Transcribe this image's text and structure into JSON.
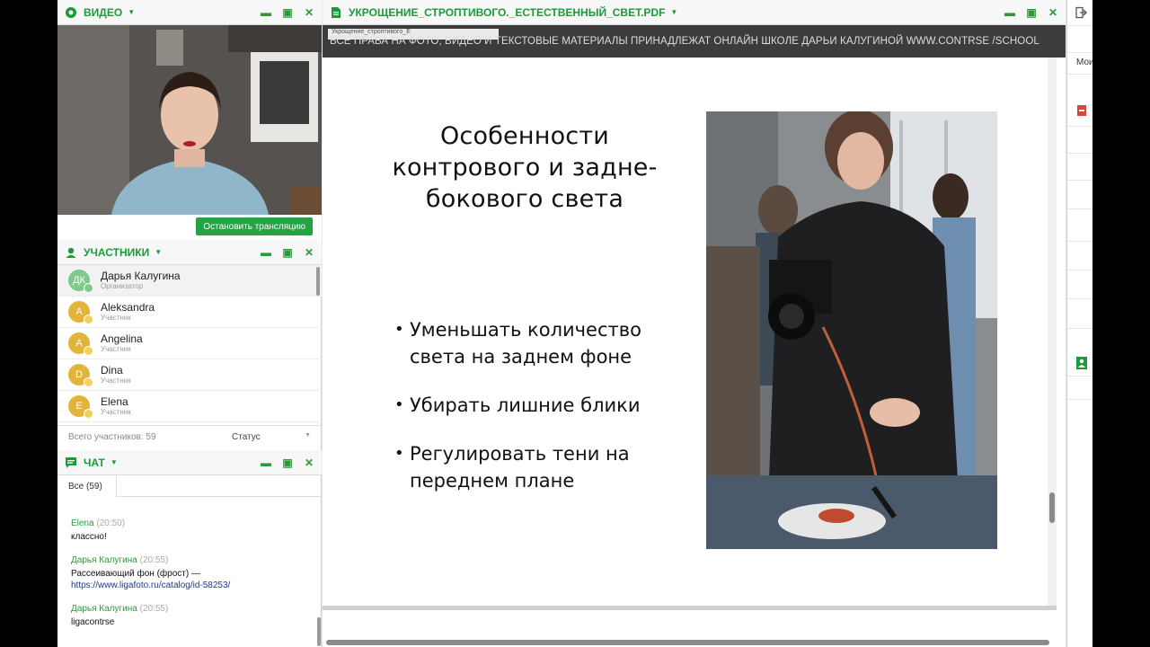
{
  "video": {
    "title": "ВИДЕО",
    "stop_button": "Остановить трансляцию"
  },
  "participants": {
    "title": "УЧАСТНИКИ",
    "list": [
      {
        "name": "Дарья Калугина",
        "role": "Организатор",
        "initials": "ДК",
        "color": "#7fc98a"
      },
      {
        "name": "Aleksandra",
        "role": "Участник",
        "initials": "A",
        "color": "#e2b43a"
      },
      {
        "name": "Angelina",
        "role": "Участник",
        "initials": "A",
        "color": "#e2b43a"
      },
      {
        "name": "Dina",
        "role": "Участник",
        "initials": "D",
        "color": "#e2b43a"
      },
      {
        "name": "Elena",
        "role": "Участник",
        "initials": "E",
        "color": "#e2b43a"
      }
    ],
    "total": "Всего участников: 59",
    "status_label": "Статус"
  },
  "chat": {
    "title": "ЧАТ",
    "tab_all": "Все (59)",
    "messages": [
      {
        "author": "Elena",
        "time": "(20:50)",
        "text": "классно!"
      },
      {
        "author": "Дарья Калугина",
        "time": "(20:55)",
        "text": "Рассеивающий фон (фрост) —",
        "link": "https://www.ligafoto.ru/catalog/id-58253/"
      },
      {
        "author": "Дарья Калугина",
        "time": "(20:55)",
        "text": "ligacontrse"
      }
    ]
  },
  "document": {
    "title": "УКРОЩЕНИЕ_СТРОПТИВОГО._ЕСТЕСТВЕННЫЙ_СВЕТ.PDF",
    "mini_tab": "Укрощение_строптивого_Е",
    "watermark": "ВСЕ ПРАВА НА ФОТО, ВИДЕО И ТЕКСТОВЫЕ МАТЕРИАЛЫ ПРИНАДЛЕЖАТ ОНЛАЙН ШКОЛЕ ДАРЬИ КАЛУГИНОЙ WWW.CONTRSE /SCHOOL",
    "slide": {
      "title_lines": [
        "Особенности",
        "контрового и задне-",
        "бокового света"
      ],
      "bullets": [
        [
          "Уменьшать количество",
          "света на заднем фоне"
        ],
        [
          "Убирать лишние блики"
        ],
        [
          "Регулировать тени на",
          "переднем плане"
        ]
      ]
    }
  },
  "right_panel": {
    "text": "Мои"
  },
  "colors": {
    "accent": "#1a9a3a",
    "button": "#25a244"
  }
}
